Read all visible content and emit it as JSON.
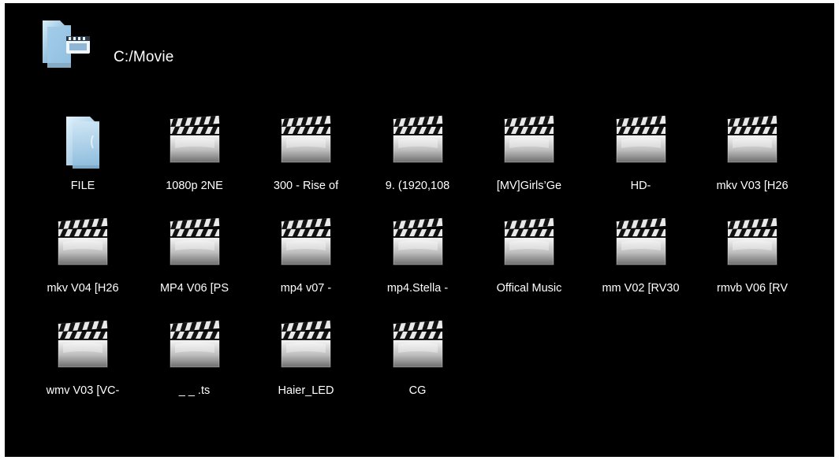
{
  "header": {
    "path": "C:/Movie",
    "icon": "video-folder-icon"
  },
  "colors": {
    "background": "#000000",
    "text": "#ffffff",
    "folder_light": "#cfe8f6",
    "folder_dark": "#6fa3c9"
  },
  "items": [
    {
      "label": "FILE",
      "icon": "folder-icon"
    },
    {
      "label": "1080p    2NE",
      "icon": "clapperboard-icon"
    },
    {
      "label": "300 - Rise of",
      "icon": "clapperboard-icon"
    },
    {
      "label": "9.  (1920,108",
      "icon": "clapperboard-icon"
    },
    {
      "label": "[MV]Girls’Ge",
      "icon": "clapperboard-icon"
    },
    {
      "label": "HD-",
      "icon": "clapperboard-icon"
    },
    {
      "label": "mkv V03 [H26",
      "icon": "clapperboard-icon"
    },
    {
      "label": "mkv V04 [H26",
      "icon": "clapperboard-icon"
    },
    {
      "label": "MP4 V06 [PS",
      "icon": "clapperboard-icon"
    },
    {
      "label": "mp4 v07   -",
      "icon": "clapperboard-icon"
    },
    {
      "label": "mp4.Stella -",
      "icon": "clapperboard-icon"
    },
    {
      "label": "Offical Music",
      "icon": "clapperboard-icon"
    },
    {
      "label": "mm V02 [RV30",
      "icon": "clapperboard-icon"
    },
    {
      "label": "rmvb V06 [RV",
      "icon": "clapperboard-icon"
    },
    {
      "label": "wmv V03 [VC-",
      "icon": "clapperboard-icon"
    },
    {
      "label": "_ _ .ts",
      "icon": "clapperboard-icon"
    },
    {
      "label": "Haier_LED",
      "icon": "clapperboard-icon"
    },
    {
      "label": "CG",
      "icon": "clapperboard-icon"
    }
  ]
}
